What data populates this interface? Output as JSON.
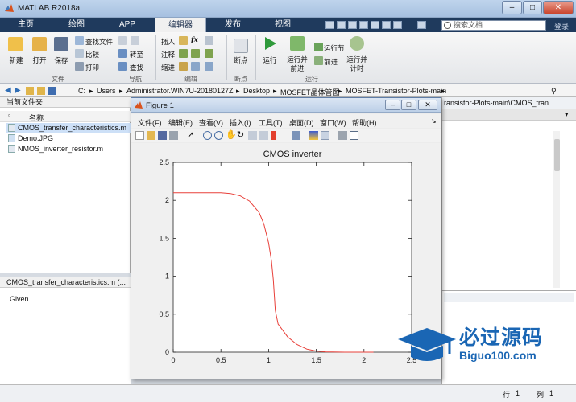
{
  "window": {
    "title": "MATLAB R2018a"
  },
  "tabs": [
    "主页",
    "绘图",
    "APP",
    "编辑器",
    "发布",
    "视图"
  ],
  "active_tab": "编辑器",
  "search": {
    "placeholder": "搜索文档",
    "right_label": "登录"
  },
  "ribbon": {
    "file_group": {
      "new": "新建",
      "open": "打开",
      "save": "保存",
      "find_files": "查找文件",
      "compare": "比较",
      "print": "打印",
      "label": "文件"
    },
    "nav_group": {
      "goto": "转至",
      "find": "查找",
      "label": "导航"
    },
    "edit_group": {
      "insert": "插入",
      "comment": "注释",
      "indent": "缩进",
      "fx": "fx",
      "label": "编辑"
    },
    "breakpoints_group": {
      "breakpoints": "断点",
      "label": "断点"
    },
    "run_group": {
      "run": "运行",
      "run_advance": "运行并前进",
      "run_section": "运行节",
      "advance": "前进",
      "run_time": "运行并计时",
      "label": "运行"
    }
  },
  "address": [
    "C:",
    "Users",
    "Administrator.WIN7U-20180127Z",
    "Desktop",
    "MOSFET晶体管图",
    "MOSFET-Transistor-Plots-main"
  ],
  "current_folder": {
    "header": "当前文件夹",
    "column_name": "名称",
    "files": [
      "CMOS_transfer_characteristics.m",
      "Demo.JPG",
      "NMOS_inverter_resistor.m"
    ],
    "selected": 0
  },
  "details": {
    "header": "CMOS_transfer_characteristics.m  (...",
    "text": "Given"
  },
  "editor": {
    "tab_path": "ransistor-Plots-main\\CMOS_tran..."
  },
  "statusbar": {
    "row_label": "行",
    "row_value": "1",
    "col_label": "列",
    "col_value": "1"
  },
  "figure": {
    "title": "Figure 1",
    "menus": [
      "文件(F)",
      "编辑(E)",
      "查看(V)",
      "插入(I)",
      "工具(T)",
      "桌面(D)",
      "窗口(W)",
      "帮助(H)"
    ],
    "toolbar_icons": [
      "new-figure-icon",
      "open-icon",
      "save-icon",
      "print-icon",
      "pointer-icon",
      "zoom-in-icon",
      "zoom-out-icon",
      "pan-icon",
      "rotate-icon",
      "data-cursor-icon",
      "brush-icon",
      "link-icon",
      "colorbar-icon",
      "legend-icon",
      "hide-tools-icon",
      "dock-icon"
    ]
  },
  "chart_data": {
    "type": "line",
    "title": "CMOS inverter",
    "xlabel": "",
    "ylabel": "",
    "xlim": [
      0,
      2.5
    ],
    "ylim": [
      0,
      2.5
    ],
    "xticks": [
      "0",
      "0.5",
      "1",
      "1.5",
      "2",
      "2.5"
    ],
    "yticks": [
      "0",
      "0.5",
      "1",
      "1.5",
      "2",
      "2.5"
    ],
    "grid": false,
    "color": "#e8403a",
    "series": [
      {
        "x": [
          0,
          0.2,
          0.4,
          0.5,
          0.6,
          0.7,
          0.8,
          0.9,
          0.95,
          1.0,
          1.03,
          1.05,
          1.07,
          1.1,
          1.2,
          1.3,
          1.4,
          1.5,
          1.6,
          1.8,
          2.0,
          2.1
        ],
        "values": [
          2.1,
          2.1,
          2.1,
          2.1,
          2.09,
          2.06,
          1.99,
          1.84,
          1.69,
          1.44,
          1.2,
          0.95,
          0.55,
          0.37,
          0.2,
          0.1,
          0.04,
          0.015,
          0.004,
          0.0,
          0.0,
          0.0
        ]
      }
    ]
  },
  "watermark": {
    "cn": "必过源码",
    "en": "Biguo100.com"
  },
  "colors": {
    "accent": "#1f3a5d",
    "line": "#e8403a",
    "watermark": "#1a66b4"
  }
}
